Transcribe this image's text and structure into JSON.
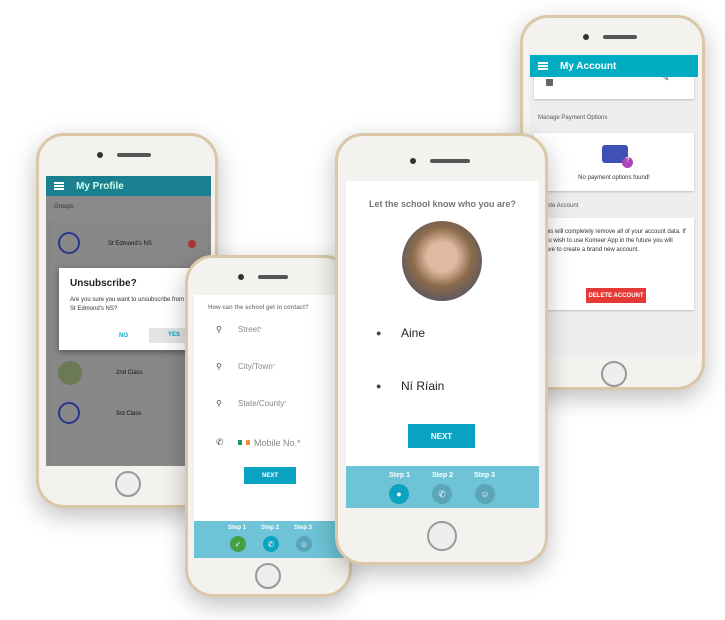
{
  "account": {
    "title": "My Account",
    "section_payment": "Manage Payment Options",
    "no_payment": "No payment options found!",
    "section_delete": "Delete Account",
    "delete_text": "This will completely remove all of your account data. If you wish to use Komeer App in the future you will have to create a brand new account.",
    "delete_button": "DELETE ACCOUNT",
    "accent": "#00acc1",
    "danger": "#e53935"
  },
  "profile": {
    "title": "My Profile",
    "section": "Groups",
    "groups": [
      "St Edmond's NS",
      "2nd Class",
      "3rd Class"
    ],
    "dialog": {
      "title": "Unsubscribe?",
      "message": "Are you sure you want to unsubscribe from St Edmond's NS?",
      "no": "NO",
      "yes": "YES"
    }
  },
  "contact": {
    "heading": "How can the school get in contact?",
    "fields": [
      "Street",
      "City/Town",
      "State/County",
      "Mobile No."
    ],
    "required_mark": "*",
    "next": "NEXT",
    "steps": [
      "Step 1",
      "Step 2",
      "Step 3"
    ]
  },
  "identity": {
    "heading": "Let the school know who you are?",
    "first_name": "Aine",
    "last_name": "Ní Ríain",
    "next": "NEXT",
    "steps": [
      "Step 1",
      "Step 2",
      "Step 3"
    ]
  }
}
